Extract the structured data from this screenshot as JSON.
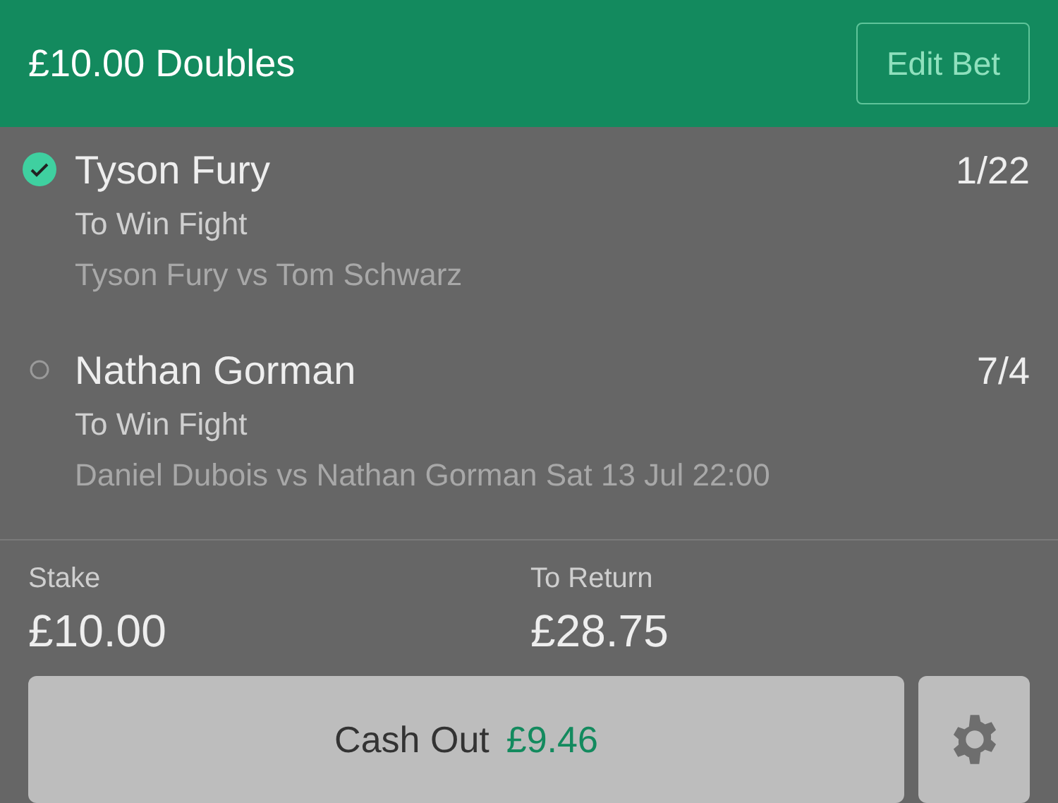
{
  "header": {
    "title": "£10.00 Doubles",
    "edit_button": "Edit Bet"
  },
  "selections": [
    {
      "name": "Tyson Fury",
      "won": true,
      "odds": "1/22",
      "market": "To Win Fight",
      "event": "Tyson Fury vs Tom Schwarz"
    },
    {
      "name": "Nathan Gorman",
      "won": false,
      "odds": "7/4",
      "market": "To Win Fight",
      "event": "Daniel Dubois vs Nathan Gorman Sat 13 Jul 22:00"
    }
  ],
  "stake": {
    "label": "Stake",
    "value": "£10.00"
  },
  "to_return": {
    "label": "To Return",
    "value": "£28.75"
  },
  "cash_out": {
    "label": "Cash Out",
    "amount": "£9.46"
  }
}
